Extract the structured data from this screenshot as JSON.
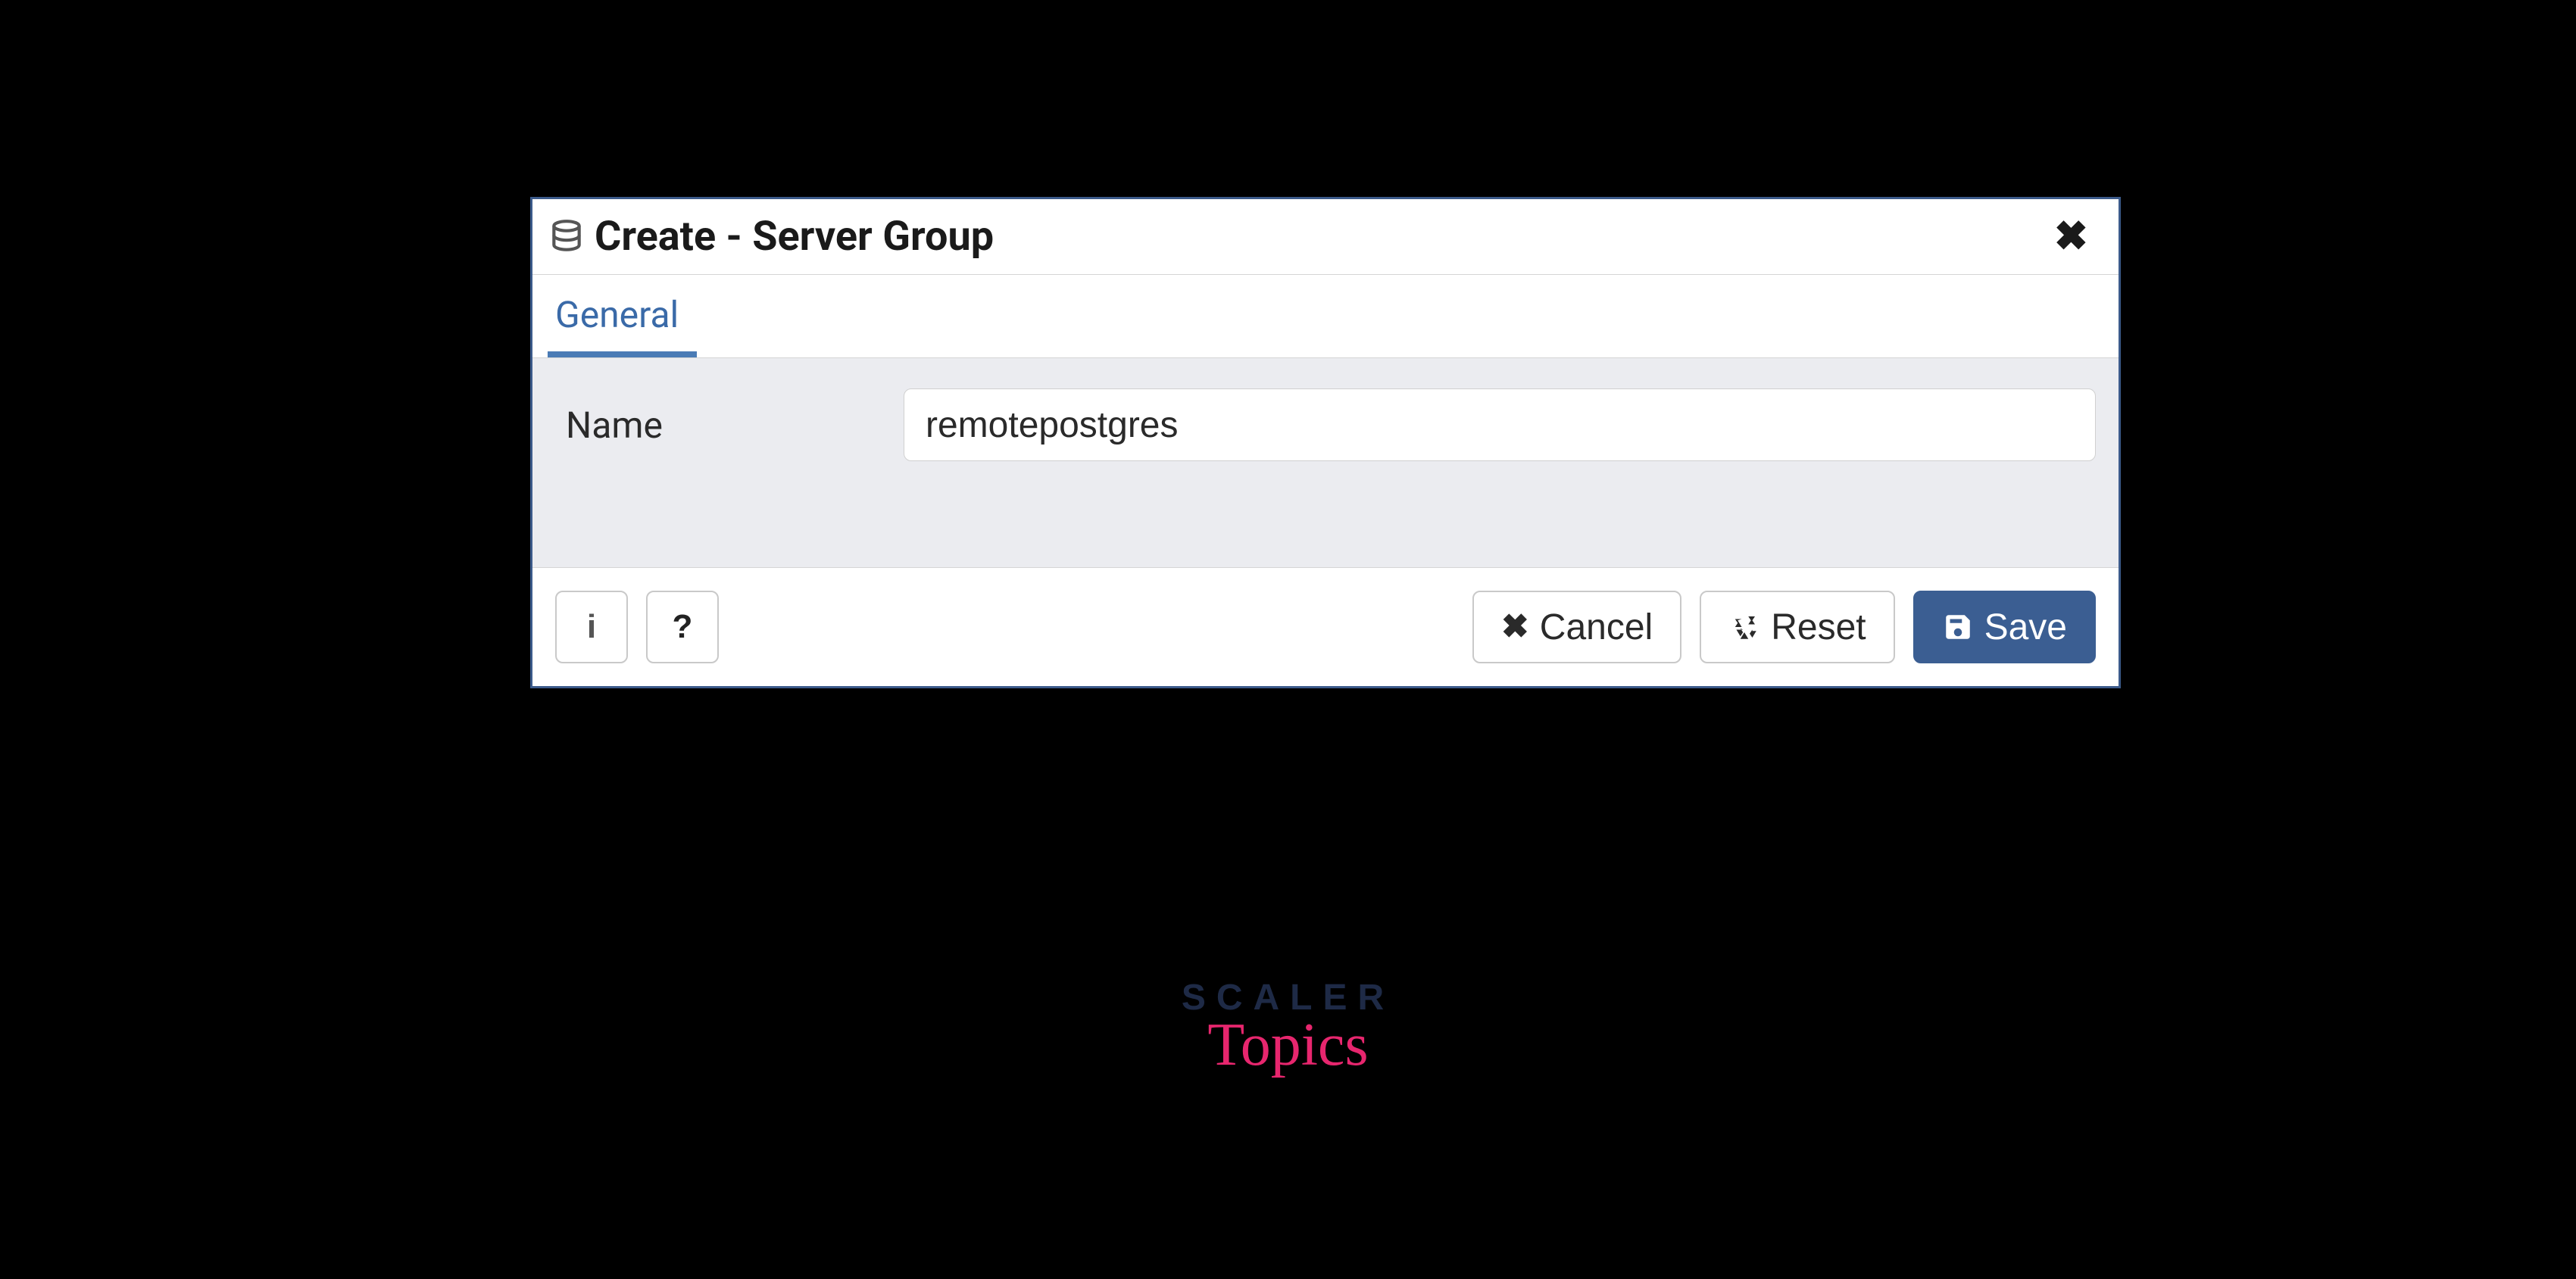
{
  "dialog": {
    "title": "Create - Server Group",
    "tabs": [
      {
        "label": "General"
      }
    ],
    "form": {
      "name_label": "Name",
      "name_value": "remotepostgres"
    },
    "footer": {
      "info_char": "i",
      "help_char": "?",
      "cancel_label": "Cancel",
      "reset_label": "Reset",
      "save_label": "Save"
    }
  },
  "watermark": {
    "line1": "SCALER",
    "line2": "Topics"
  }
}
